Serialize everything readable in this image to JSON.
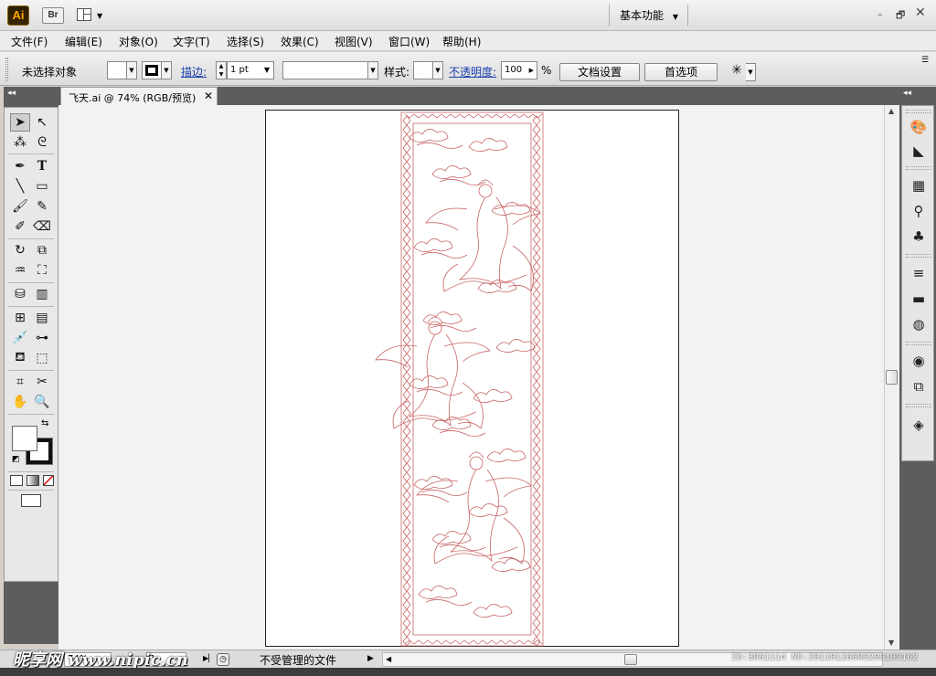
{
  "app": {
    "logo": "Ai",
    "bridge": "Br",
    "workspace": "基本功能"
  },
  "window_controls": {
    "minimize": "–",
    "maximize": "🗗",
    "close": "✕"
  },
  "menu": [
    "文件(F)",
    "编辑(E)",
    "对象(O)",
    "文字(T)",
    "选择(S)",
    "效果(C)",
    "视图(V)",
    "窗口(W)",
    "帮助(H)"
  ],
  "control_bar": {
    "selection_status": "未选择对象",
    "stroke_label": "描边:",
    "stroke_weight": "1 pt",
    "style_label": "样式:",
    "opacity_label": "不透明度:",
    "opacity_value": "100",
    "opacity_unit": "%",
    "doc_setup": "文档设置",
    "preferences": "首选项"
  },
  "document": {
    "tab_title": "飞天.ai @ 74% (RGB/预览)",
    "line_color": "#c86464"
  },
  "status_bar": {
    "zoom": "74%",
    "page": "1",
    "status_text": "不受管理的文件"
  },
  "watermark": {
    "site": "昵享网 www.nipic.cn",
    "image_id": "ID:3961114 NO:20110126000200109162"
  },
  "icons": {
    "selection": "selection-tool-icon",
    "direct_selection": "direct-selection-tool-icon",
    "pen": "pen-tool-icon",
    "type": "type-tool-icon"
  }
}
